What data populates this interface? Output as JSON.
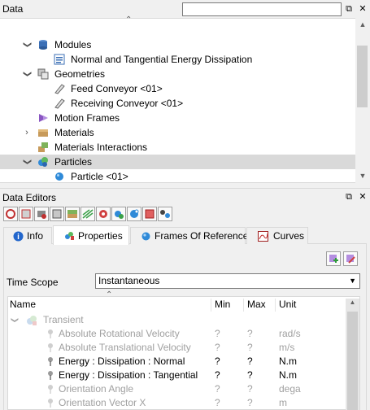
{
  "data_panel": {
    "title": "Data",
    "search_value": "",
    "tree": [
      {
        "label": "Modules",
        "twisty": "expanded",
        "icon": "database-icon",
        "level": 0
      },
      {
        "label": "Normal and Tangential Energy Dissipation",
        "twisty": "none",
        "icon": "module-doc-icon",
        "level": 1
      },
      {
        "label": "Geometries",
        "twisty": "expanded",
        "icon": "geometries-icon",
        "level": 0
      },
      {
        "label": "Feed Conveyor <01>",
        "twisty": "none",
        "icon": "conveyor-icon",
        "level": 1
      },
      {
        "label": "Receiving Conveyor <01>",
        "twisty": "none",
        "icon": "conveyor-icon",
        "level": 1
      },
      {
        "label": "Motion Frames",
        "twisty": "none",
        "icon": "motion-frames-icon",
        "level": 0
      },
      {
        "label": "Materials",
        "twisty": "collapsed",
        "icon": "materials-icon",
        "level": 0
      },
      {
        "label": "Materials Interactions",
        "twisty": "none",
        "icon": "materials-interactions-icon",
        "level": 0
      },
      {
        "label": "Particles",
        "twisty": "expanded",
        "icon": "particles-icon",
        "level": 0,
        "selected": true
      },
      {
        "label": "Particle <01>",
        "twisty": "none",
        "icon": "particle-icon",
        "level": 1
      }
    ]
  },
  "editors_panel": {
    "title": "Data Editors",
    "toolbar_icons": [
      "tool-1-icon",
      "tool-2-icon",
      "tool-3-icon",
      "tool-4-icon",
      "tool-5-icon",
      "tool-6-icon",
      "tool-7-icon",
      "tool-8-icon",
      "tool-9-icon",
      "tool-10-icon",
      "tool-11-icon"
    ],
    "tabs": [
      {
        "label": "Info",
        "icon": "info-icon"
      },
      {
        "label": "Properties",
        "icon": "properties-icon",
        "active": true
      },
      {
        "label": "Frames Of Reference",
        "icon": "frames-of-reference-icon"
      },
      {
        "label": "Curves",
        "icon": "curves-icon"
      }
    ],
    "time_scope_label": "Time Scope",
    "time_scope_value": "Instantaneous",
    "columns": {
      "name": "Name",
      "min": "Min",
      "max": "Max",
      "unit": "Unit"
    },
    "group_label": "Transient",
    "properties": [
      {
        "name": "Absolute Rotational Velocity",
        "min": "?",
        "max": "?",
        "unit": "rad/s",
        "enabled": false
      },
      {
        "name": "Absolute Translational Velocity",
        "min": "?",
        "max": "?",
        "unit": "m/s",
        "enabled": false
      },
      {
        "name": "Energy : Dissipation : Normal",
        "min": "?",
        "max": "?",
        "unit": "N.m",
        "enabled": true
      },
      {
        "name": "Energy : Dissipation : Tangential",
        "min": "?",
        "max": "?",
        "unit": "N.m",
        "enabled": true
      },
      {
        "name": "Orientation Angle",
        "min": "?",
        "max": "?",
        "unit": "dega",
        "enabled": false
      },
      {
        "name": "Orientation Vector X",
        "min": "?",
        "max": "?",
        "unit": "m",
        "enabled": false
      }
    ]
  }
}
